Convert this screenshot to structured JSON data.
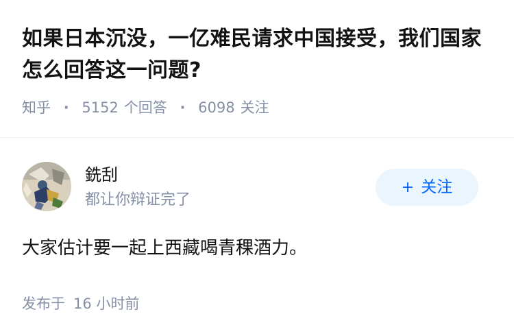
{
  "question": {
    "title": "如果日本沉没，一亿难民请求中国接受，我们国家怎么回答这一问题?",
    "source": "知乎",
    "answers_count": "5152",
    "answers_label": "个回答",
    "followers_count": "6098",
    "followers_label": "关注"
  },
  "answer": {
    "author_name": "銑刮",
    "author_bio": "都让你辩证完了",
    "follow_button": "关注",
    "follow_icon": "+",
    "content": "大家估计要一起上西藏喝青稞酒力。",
    "publish_label": "发布于",
    "publish_time": "16 小时前"
  },
  "colors": {
    "text": "#121212",
    "meta": "#8590a6",
    "accent": "#0066ff",
    "button_bg": "#ebf5fd"
  }
}
